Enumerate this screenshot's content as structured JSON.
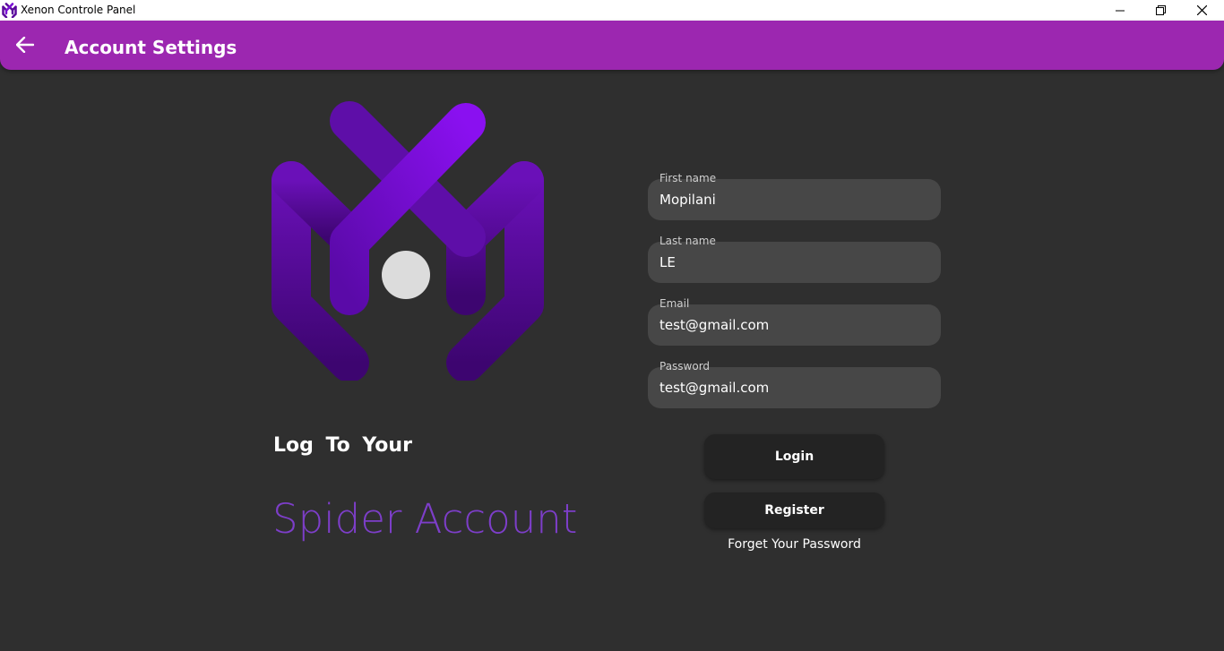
{
  "window": {
    "title": "Xenon Controle Panel",
    "minimize_icon": "minimize-icon",
    "maximize_icon": "restore-icon",
    "close_icon": "close-icon"
  },
  "header": {
    "title": "Account Settings",
    "back_icon": "arrow-left-icon",
    "background": "#9c27b0"
  },
  "hero": {
    "line1": "Log  To  Your",
    "line2": "Spider Account",
    "accent": "#7d3ec9"
  },
  "form": {
    "first_name": {
      "label": "First name",
      "value": "Mopilani"
    },
    "last_name": {
      "label": "Last name",
      "value": "LE"
    },
    "email": {
      "label": "Email",
      "value": "test@gmail.com"
    },
    "password": {
      "label": "Password",
      "value": "test@gmail.com"
    }
  },
  "actions": {
    "login": "Login",
    "register": "Register",
    "forgot": "Forget Your Password"
  }
}
